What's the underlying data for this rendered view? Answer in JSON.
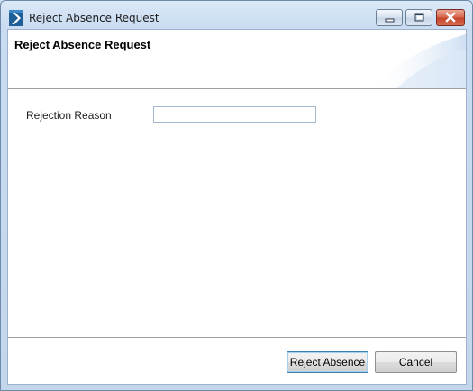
{
  "window": {
    "title": "Reject Absence Request",
    "controls": {
      "minimize": "minimize",
      "maximize": "maximize",
      "close": "close"
    }
  },
  "header": {
    "title": "Reject Absence Request"
  },
  "form": {
    "rejection_reason_label": "Rejection Reason",
    "rejection_reason_value": ""
  },
  "footer": {
    "reject_label": "Reject Absence",
    "cancel_label": "Cancel"
  },
  "colors": {
    "accent": "#2f7bbf",
    "close_button": "#c4422a"
  },
  "icons": [
    "app-icon",
    "minimize-icon",
    "maximize-icon",
    "close-icon"
  ]
}
